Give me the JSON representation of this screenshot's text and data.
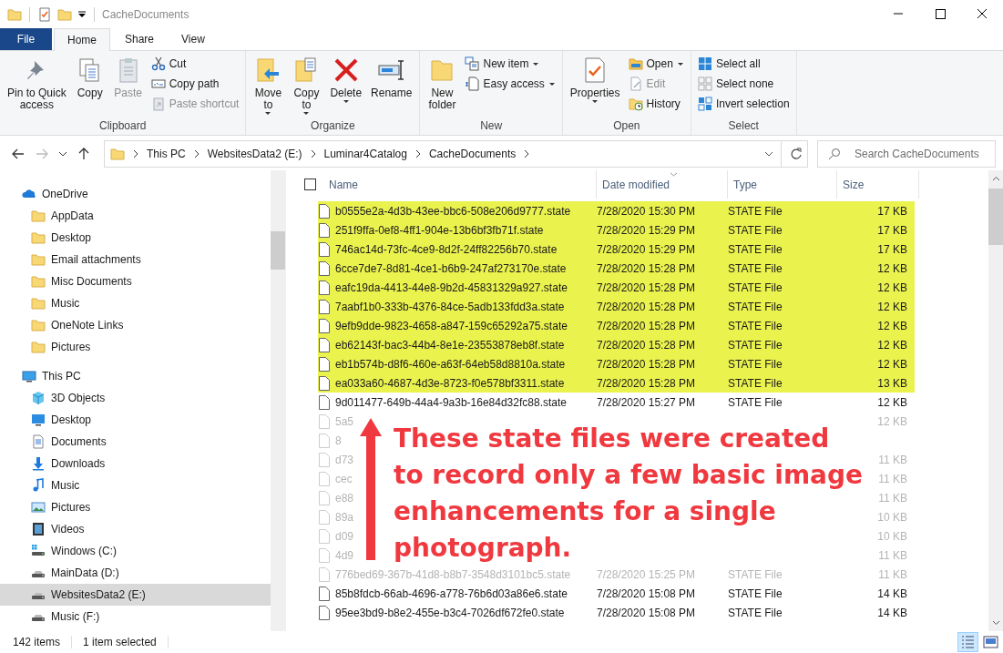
{
  "window": {
    "title": "CacheDocuments"
  },
  "menu_tabs": [
    {
      "label": "File",
      "kind": "file",
      "selected": false
    },
    {
      "label": "Home",
      "kind": "tab",
      "selected": true
    },
    {
      "label": "Share",
      "kind": "tab",
      "selected": false
    },
    {
      "label": "View",
      "kind": "tab",
      "selected": false
    }
  ],
  "ribbon": {
    "groups": [
      {
        "label": "Clipboard",
        "items": [
          {
            "label": "Pin to Quick\naccess",
            "kind": "pin",
            "disabled": false,
            "dropdown": false
          },
          {
            "label": "Copy",
            "kind": "copy",
            "disabled": false,
            "dropdown": false
          },
          {
            "label": "Paste",
            "kind": "paste",
            "disabled": true,
            "dropdown": false
          },
          {
            "stack": [
              {
                "label": "Cut",
                "kind": "cut",
                "disabled": false,
                "dropdown": false
              },
              {
                "label": "Copy path",
                "kind": "copypath",
                "disabled": false,
                "dropdown": false
              },
              {
                "label": "Paste shortcut",
                "kind": "pasteshortcut",
                "disabled": true,
                "dropdown": false
              }
            ]
          }
        ]
      },
      {
        "label": "Organize",
        "items": [
          {
            "label": "Move\nto",
            "kind": "move",
            "disabled": false,
            "dropdown": true
          },
          {
            "label": "Copy\nto",
            "kind": "copyto",
            "disabled": false,
            "dropdown": true
          },
          {
            "label": "Delete",
            "kind": "delete",
            "disabled": false,
            "dropdown": true
          },
          {
            "label": "Rename",
            "kind": "rename",
            "disabled": false,
            "dropdown": false
          }
        ]
      },
      {
        "label": "New",
        "items": [
          {
            "label": "New\nfolder",
            "kind": "newfolder",
            "disabled": false,
            "dropdown": false
          },
          {
            "stack": [
              {
                "label": "New item",
                "kind": "newitem",
                "disabled": false,
                "dropdown": true
              },
              {
                "label": "Easy access",
                "kind": "easyaccess",
                "disabled": false,
                "dropdown": true
              }
            ]
          }
        ]
      },
      {
        "label": "Open",
        "items": [
          {
            "label": "Properties",
            "kind": "properties",
            "disabled": false,
            "dropdown": true
          },
          {
            "stack": [
              {
                "label": "Open",
                "kind": "open",
                "disabled": false,
                "dropdown": true
              },
              {
                "label": "Edit",
                "kind": "edit",
                "disabled": true,
                "dropdown": false
              },
              {
                "label": "History",
                "kind": "history",
                "disabled": false,
                "dropdown": false
              }
            ]
          }
        ]
      },
      {
        "label": "Select",
        "items": [
          {
            "stack": [
              {
                "label": "Select all",
                "kind": "selectall",
                "disabled": false,
                "dropdown": false
              },
              {
                "label": "Select none",
                "kind": "selectnone",
                "disabled": false,
                "dropdown": false
              },
              {
                "label": "Invert selection",
                "kind": "invert",
                "disabled": false,
                "dropdown": false
              }
            ]
          }
        ]
      }
    ]
  },
  "address": {
    "path": [
      "This PC",
      "WebsitesData2 (E:)",
      "Luminar4Catalog",
      "CacheDocuments"
    ],
    "search": {
      "placeholder": "Search CacheDocuments"
    }
  },
  "sidebar": {
    "items": [
      {
        "label": "OneDrive",
        "kind": "cloud",
        "selected": false,
        "children": [
          {
            "label": "AppData",
            "kind": "folder",
            "selected": false
          },
          {
            "label": "Desktop",
            "kind": "folder",
            "selected": false
          },
          {
            "label": "Email attachments",
            "kind": "folder",
            "selected": false
          },
          {
            "label": "Misc Documents",
            "kind": "folder",
            "selected": false
          },
          {
            "label": "Music",
            "kind": "folder",
            "selected": false
          },
          {
            "label": "OneNote Links",
            "kind": "folder",
            "selected": false
          },
          {
            "label": "Pictures",
            "kind": "folder",
            "selected": false
          }
        ]
      },
      {
        "label": "This PC",
        "kind": "pc",
        "selected": false,
        "children": [
          {
            "label": "3D Objects",
            "kind": "objects",
            "selected": false
          },
          {
            "label": "Desktop",
            "kind": "desktop",
            "selected": false
          },
          {
            "label": "Documents",
            "kind": "documents",
            "selected": false
          },
          {
            "label": "Downloads",
            "kind": "downloads",
            "selected": false
          },
          {
            "label": "Music",
            "kind": "music",
            "selected": false
          },
          {
            "label": "Pictures",
            "kind": "pictures",
            "selected": false
          },
          {
            "label": "Videos",
            "kind": "videos",
            "selected": false
          },
          {
            "label": "Windows (C:)",
            "kind": "windrive",
            "selected": false
          },
          {
            "label": "MainData (D:)",
            "kind": "drive",
            "selected": false
          },
          {
            "label": "WebsitesData2 (E:)",
            "kind": "drive",
            "selected": true
          },
          {
            "label": "Music (F:)",
            "kind": "drive",
            "selected": false
          }
        ]
      }
    ]
  },
  "table": {
    "select_all": {
      "checked": false
    },
    "columns": [
      {
        "label": "Name",
        "sorted": false
      },
      {
        "label": "Date modified",
        "sorted": true
      },
      {
        "label": "Type",
        "sorted": false
      },
      {
        "label": "Size",
        "sorted": false
      }
    ],
    "rows": [
      {
        "name": "b0555e2a-4d3b-43ee-bbc6-508e206d9777.state",
        "date": "7/28/2020 15:30 PM",
        "type": "STATE File",
        "size": "17 KB",
        "highlighted": true,
        "faded": false
      },
      {
        "name": "251f9ffa-0ef8-4ff1-904e-13b6bf3fb71f.state",
        "date": "7/28/2020 15:29 PM",
        "type": "STATE File",
        "size": "17 KB",
        "highlighted": true,
        "faded": false
      },
      {
        "name": "746ac14d-73fc-4ce9-8d2f-24ff82256b70.state",
        "date": "7/28/2020 15:29 PM",
        "type": "STATE File",
        "size": "17 KB",
        "highlighted": true,
        "faded": false
      },
      {
        "name": "6cce7de7-8d81-4ce1-b6b9-247af273170e.state",
        "date": "7/28/2020 15:28 PM",
        "type": "STATE File",
        "size": "12 KB",
        "highlighted": true,
        "faded": false
      },
      {
        "name": "eafc19da-4413-44e8-9b2d-45831329a927.state",
        "date": "7/28/2020 15:28 PM",
        "type": "STATE File",
        "size": "12 KB",
        "highlighted": true,
        "faded": false
      },
      {
        "name": "7aabf1b0-333b-4376-84ce-5adb133fdd3a.state",
        "date": "7/28/2020 15:28 PM",
        "type": "STATE File",
        "size": "12 KB",
        "highlighted": true,
        "faded": false
      },
      {
        "name": "9efb9dde-9823-4658-a847-159c65292a75.state",
        "date": "7/28/2020 15:28 PM",
        "type": "STATE File",
        "size": "12 KB",
        "highlighted": true,
        "faded": false
      },
      {
        "name": "eb62143f-bac3-44b4-8e1e-23553878eb8f.state",
        "date": "7/28/2020 15:28 PM",
        "type": "STATE File",
        "size": "12 KB",
        "highlighted": true,
        "faded": false
      },
      {
        "name": "eb1b574b-d8f6-460e-a63f-64eb58d8810a.state",
        "date": "7/28/2020 15:28 PM",
        "type": "STATE File",
        "size": "12 KB",
        "highlighted": true,
        "faded": false
      },
      {
        "name": "ea033a60-4687-4d3e-8723-f0e578bf3311.state",
        "date": "7/28/2020 15:28 PM",
        "type": "STATE File",
        "size": "13 KB",
        "highlighted": true,
        "faded": false
      },
      {
        "name": "9d011477-649b-44a4-9a3b-16e84d32fc88.state",
        "date": "7/28/2020 15:27 PM",
        "type": "STATE File",
        "size": "12 KB",
        "highlighted": false,
        "faded": false
      },
      {
        "name": "5a5",
        "size": "12 KB",
        "highlighted": false,
        "faded": true
      },
      {
        "name": "8",
        "highlighted": false,
        "faded": true
      },
      {
        "name": "d73",
        "size": "11 KB",
        "highlighted": false,
        "faded": true
      },
      {
        "name": "cec",
        "size": "11 KB",
        "highlighted": false,
        "faded": true
      },
      {
        "name": "e88",
        "size": "11 KB",
        "highlighted": false,
        "faded": true
      },
      {
        "name": "89a",
        "size": "10 KB",
        "highlighted": false,
        "faded": true
      },
      {
        "name": "d09",
        "size": "10 KB",
        "highlighted": false,
        "faded": true
      },
      {
        "name": "4d9",
        "size": "11 KB",
        "highlighted": false,
        "faded": true
      },
      {
        "name": "776bed69-367b-41d8-b8b7-3548d3101bc5.state",
        "date": "7/28/2020 15:25 PM",
        "type": "STATE File",
        "size": "11 KB",
        "highlighted": false,
        "faded": true
      },
      {
        "name": "85b8fdcb-66ab-4696-a778-76b6d03a86e6.state",
        "date": "7/28/2020 15:08 PM",
        "type": "STATE File",
        "size": "14 KB",
        "highlighted": false,
        "faded": false
      },
      {
        "name": "95ee3bd9-b8e2-455e-b3c4-7026df672fe0.state",
        "date": "7/28/2020 15:08 PM",
        "type": "STATE File",
        "size": "14 KB",
        "highlighted": false,
        "faded": false
      }
    ]
  },
  "annotation": {
    "text": "These state files were created to record only a few basic image enhancements for a single photograph."
  },
  "status_bar": {
    "items": [
      "142 items",
      "1 item selected"
    ],
    "views": [
      {
        "kind": "details",
        "selected": true
      },
      {
        "kind": "large",
        "selected": false
      }
    ]
  }
}
